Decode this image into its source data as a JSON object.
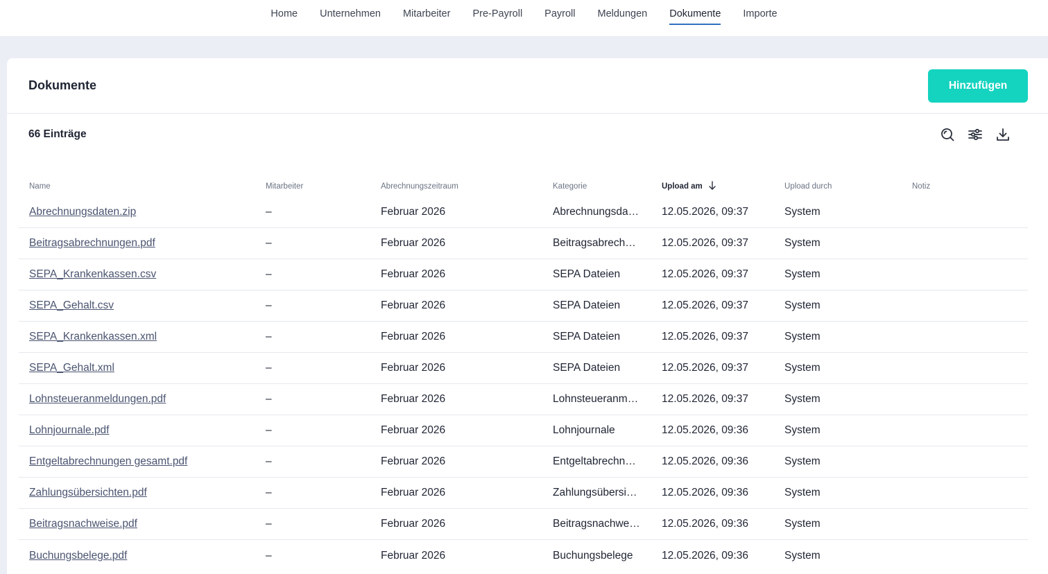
{
  "nav": {
    "items": [
      {
        "label": "Home"
      },
      {
        "label": "Unternehmen"
      },
      {
        "label": "Mitarbeiter"
      },
      {
        "label": "Pre-Payroll"
      },
      {
        "label": "Payroll"
      },
      {
        "label": "Meldungen"
      },
      {
        "label": "Dokumente",
        "active": true
      },
      {
        "label": "Importe"
      }
    ]
  },
  "page": {
    "title": "Dokumente",
    "add_label": "Hinzufügen",
    "count_label": "66 Einträge"
  },
  "toolbar_icons": [
    "search-icon",
    "filter-sliders-icon",
    "download-icon"
  ],
  "colors": {
    "accent": "#14d3bf",
    "nav_active_underline": "#2f6fbf",
    "background": "#eceef5"
  },
  "table": {
    "columns": [
      {
        "label": "Name"
      },
      {
        "label": "Mitarbeiter"
      },
      {
        "label": "Abrechnungszeitraum"
      },
      {
        "label": "Kategorie"
      },
      {
        "label": "Upload am",
        "sorted": "desc"
      },
      {
        "label": "Upload durch"
      },
      {
        "label": "Notiz"
      }
    ],
    "rows": [
      {
        "name": "Abrechnungsdaten.zip",
        "employee": "–",
        "period": "Februar 2026",
        "category": "Abrechnungsda…",
        "uploaded_at": "12.05.2026, 09:37",
        "uploaded_by": "System",
        "note": ""
      },
      {
        "name": "Beitragsabrechnungen.pdf",
        "employee": "–",
        "period": "Februar 2026",
        "category": "Beitragsabrech…",
        "uploaded_at": "12.05.2026, 09:37",
        "uploaded_by": "System",
        "note": ""
      },
      {
        "name": "SEPA_Krankenkassen.csv",
        "employee": "–",
        "period": "Februar 2026",
        "category": "SEPA Dateien",
        "uploaded_at": "12.05.2026, 09:37",
        "uploaded_by": "System",
        "note": ""
      },
      {
        "name": "SEPA_Gehalt.csv",
        "employee": "–",
        "period": "Februar 2026",
        "category": "SEPA Dateien",
        "uploaded_at": "12.05.2026, 09:37",
        "uploaded_by": "System",
        "note": ""
      },
      {
        "name": "SEPA_Krankenkassen.xml",
        "employee": "–",
        "period": "Februar 2026",
        "category": "SEPA Dateien",
        "uploaded_at": "12.05.2026, 09:37",
        "uploaded_by": "System",
        "note": ""
      },
      {
        "name": "SEPA_Gehalt.xml",
        "employee": "–",
        "period": "Februar 2026",
        "category": "SEPA Dateien",
        "uploaded_at": "12.05.2026, 09:37",
        "uploaded_by": "System",
        "note": ""
      },
      {
        "name": "Lohnsteueranmeldungen.pdf",
        "employee": "–",
        "period": "Februar 2026",
        "category": "Lohnsteueranm…",
        "uploaded_at": "12.05.2026, 09:37",
        "uploaded_by": "System",
        "note": ""
      },
      {
        "name": "Lohnjournale.pdf",
        "employee": "–",
        "period": "Februar 2026",
        "category": "Lohnjournale",
        "uploaded_at": "12.05.2026, 09:36",
        "uploaded_by": "System",
        "note": ""
      },
      {
        "name": "Entgeltabrechnungen gesamt.pdf",
        "employee": "–",
        "period": "Februar 2026",
        "category": "Entgeltabrechn…",
        "uploaded_at": "12.05.2026, 09:36",
        "uploaded_by": "System",
        "note": ""
      },
      {
        "name": "Zahlungsübersichten.pdf",
        "employee": "–",
        "period": "Februar 2026",
        "category": "Zahlungsübersi…",
        "uploaded_at": "12.05.2026, 09:36",
        "uploaded_by": "System",
        "note": ""
      },
      {
        "name": "Beitragsnachweise.pdf",
        "employee": "–",
        "period": "Februar 2026",
        "category": "Beitragsnachwe…",
        "uploaded_at": "12.05.2026, 09:36",
        "uploaded_by": "System",
        "note": ""
      },
      {
        "name": "Buchungsbelege.pdf",
        "employee": "–",
        "period": "Februar 2026",
        "category": "Buchungsbelege",
        "uploaded_at": "12.05.2026, 09:36",
        "uploaded_by": "System",
        "note": ""
      }
    ]
  }
}
